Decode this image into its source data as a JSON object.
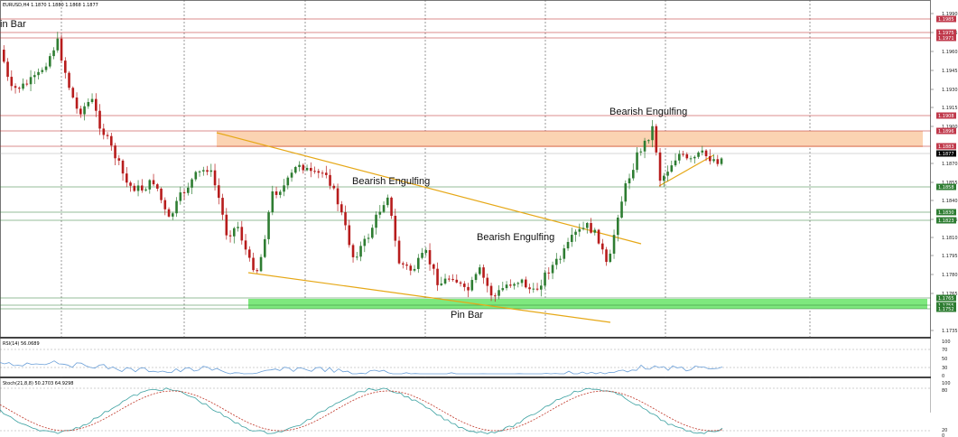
{
  "symbol_header": "EURUSD,H4  1.1870 1.1880 1.1868 1.1877",
  "corner_label": "in Bar",
  "annotations": {
    "pin_bar": "Pin Bar",
    "bearish_engulfing_1": "Bearish Engulfing",
    "bearish_engulfing_2": "Bearish Engulfing",
    "bearish_engulfing_3": "Bearish Engulfing"
  },
  "price_axis": [
    "1.1990",
    "1.1975",
    "1.1960",
    "1.1945",
    "1.1930",
    "1.1915",
    "1.1900",
    "1.1870",
    "1.1855",
    "1.1840",
    "1.1825",
    "1.1810",
    "1.1795",
    "1.1780",
    "1.1765",
    "1.1735"
  ],
  "level_tags": [
    {
      "text": "1.1985",
      "color": "#c0394b"
    },
    {
      "text": "1.1975",
      "color": "#c0394b"
    },
    {
      "text": "1.1971",
      "color": "#c0394b"
    },
    {
      "text": "1.1908",
      "color": "#c0394b"
    },
    {
      "text": "1.1896",
      "color": "#c0394b"
    },
    {
      "text": "1.1883",
      "color": "#c0394b"
    },
    {
      "text": "1.1877",
      "color": "#000000"
    },
    {
      "text": "1.1858",
      "color": "#2e7d32"
    },
    {
      "text": "1.1830",
      "color": "#2e7d32"
    },
    {
      "text": "1.1823",
      "color": "#2e7d32"
    },
    {
      "text": "1.1765",
      "color": "#2e7d32"
    },
    {
      "text": "1.1755",
      "color": "#2e7d32"
    },
    {
      "text": "1.1752",
      "color": "#2e7d32"
    }
  ],
  "rsi": {
    "title": "RSI(14) 56.0689",
    "axis": [
      "100",
      "70",
      "50",
      "30",
      "0"
    ]
  },
  "stoch": {
    "title": "Stoch(21,8,8) 50.2703 64.9298",
    "axis": [
      "100",
      "80",
      "20",
      "0"
    ]
  },
  "colors": {
    "bull": "#2e7d32",
    "bear": "#b71c1c",
    "resistance_zone": "#fbd3b2",
    "support_zone": "#7ee87e",
    "channel": "#e6a817",
    "rsi_line": "#6a9fd8",
    "stoch_main": "#3aa0a0",
    "stoch_signal": "#c0392b"
  }
}
